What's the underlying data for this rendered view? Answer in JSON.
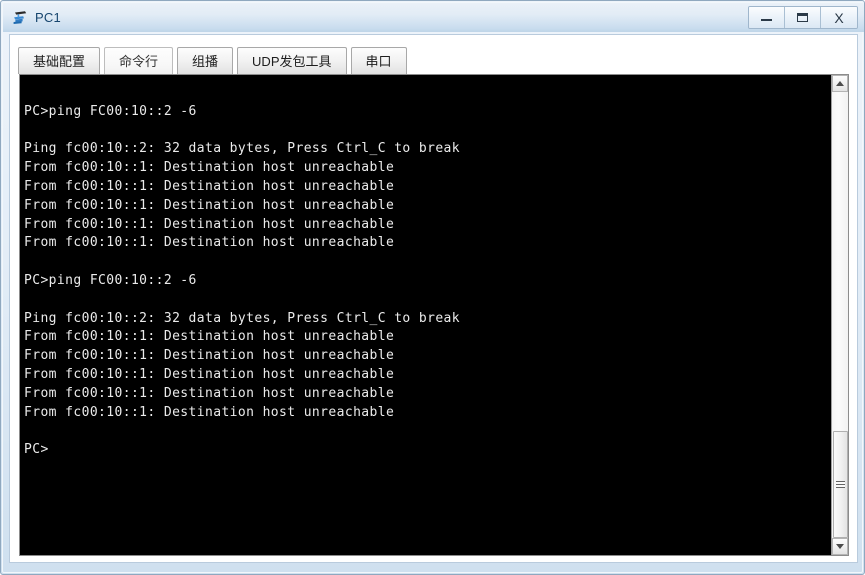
{
  "window": {
    "title": "PC1",
    "icon": "pc-device-icon",
    "controls": {
      "minimize_label": "–",
      "maximize_label": "□",
      "close_label": "X"
    }
  },
  "tabs": [
    {
      "label": "基础配置",
      "name": "tab-basic-config",
      "selected": false
    },
    {
      "label": "命令行",
      "name": "tab-command-line",
      "selected": true
    },
    {
      "label": "组播",
      "name": "tab-multicast",
      "selected": false
    },
    {
      "label": "UDP发包工具",
      "name": "tab-udp-sender",
      "selected": false
    },
    {
      "label": "串口",
      "name": "tab-serial-port",
      "selected": false
    }
  ],
  "terminal": {
    "background_color": "#000000",
    "text_color": "#ebebeb",
    "lines": [
      "",
      "PC>ping FC00:10::2 -6",
      "",
      "Ping fc00:10::2: 32 data bytes, Press Ctrl_C to break",
      "From fc00:10::1: Destination host unreachable",
      "From fc00:10::1: Destination host unreachable",
      "From fc00:10::1: Destination host unreachable",
      "From fc00:10::1: Destination host unreachable",
      "From fc00:10::1: Destination host unreachable",
      "",
      "PC>ping FC00:10::2 -6",
      "",
      "Ping fc00:10::2: 32 data bytes, Press Ctrl_C to break",
      "From fc00:10::1: Destination host unreachable",
      "From fc00:10::1: Destination host unreachable",
      "From fc00:10::1: Destination host unreachable",
      "From fc00:10::1: Destination host unreachable",
      "From fc00:10::1: Destination host unreachable",
      "",
      "PC>"
    ]
  },
  "scrollbar": {
    "up_arrow": "scroll-up-arrow",
    "down_arrow": "scroll-down-arrow",
    "thumb_top_pct": 76,
    "thumb_height_pct": 24
  }
}
